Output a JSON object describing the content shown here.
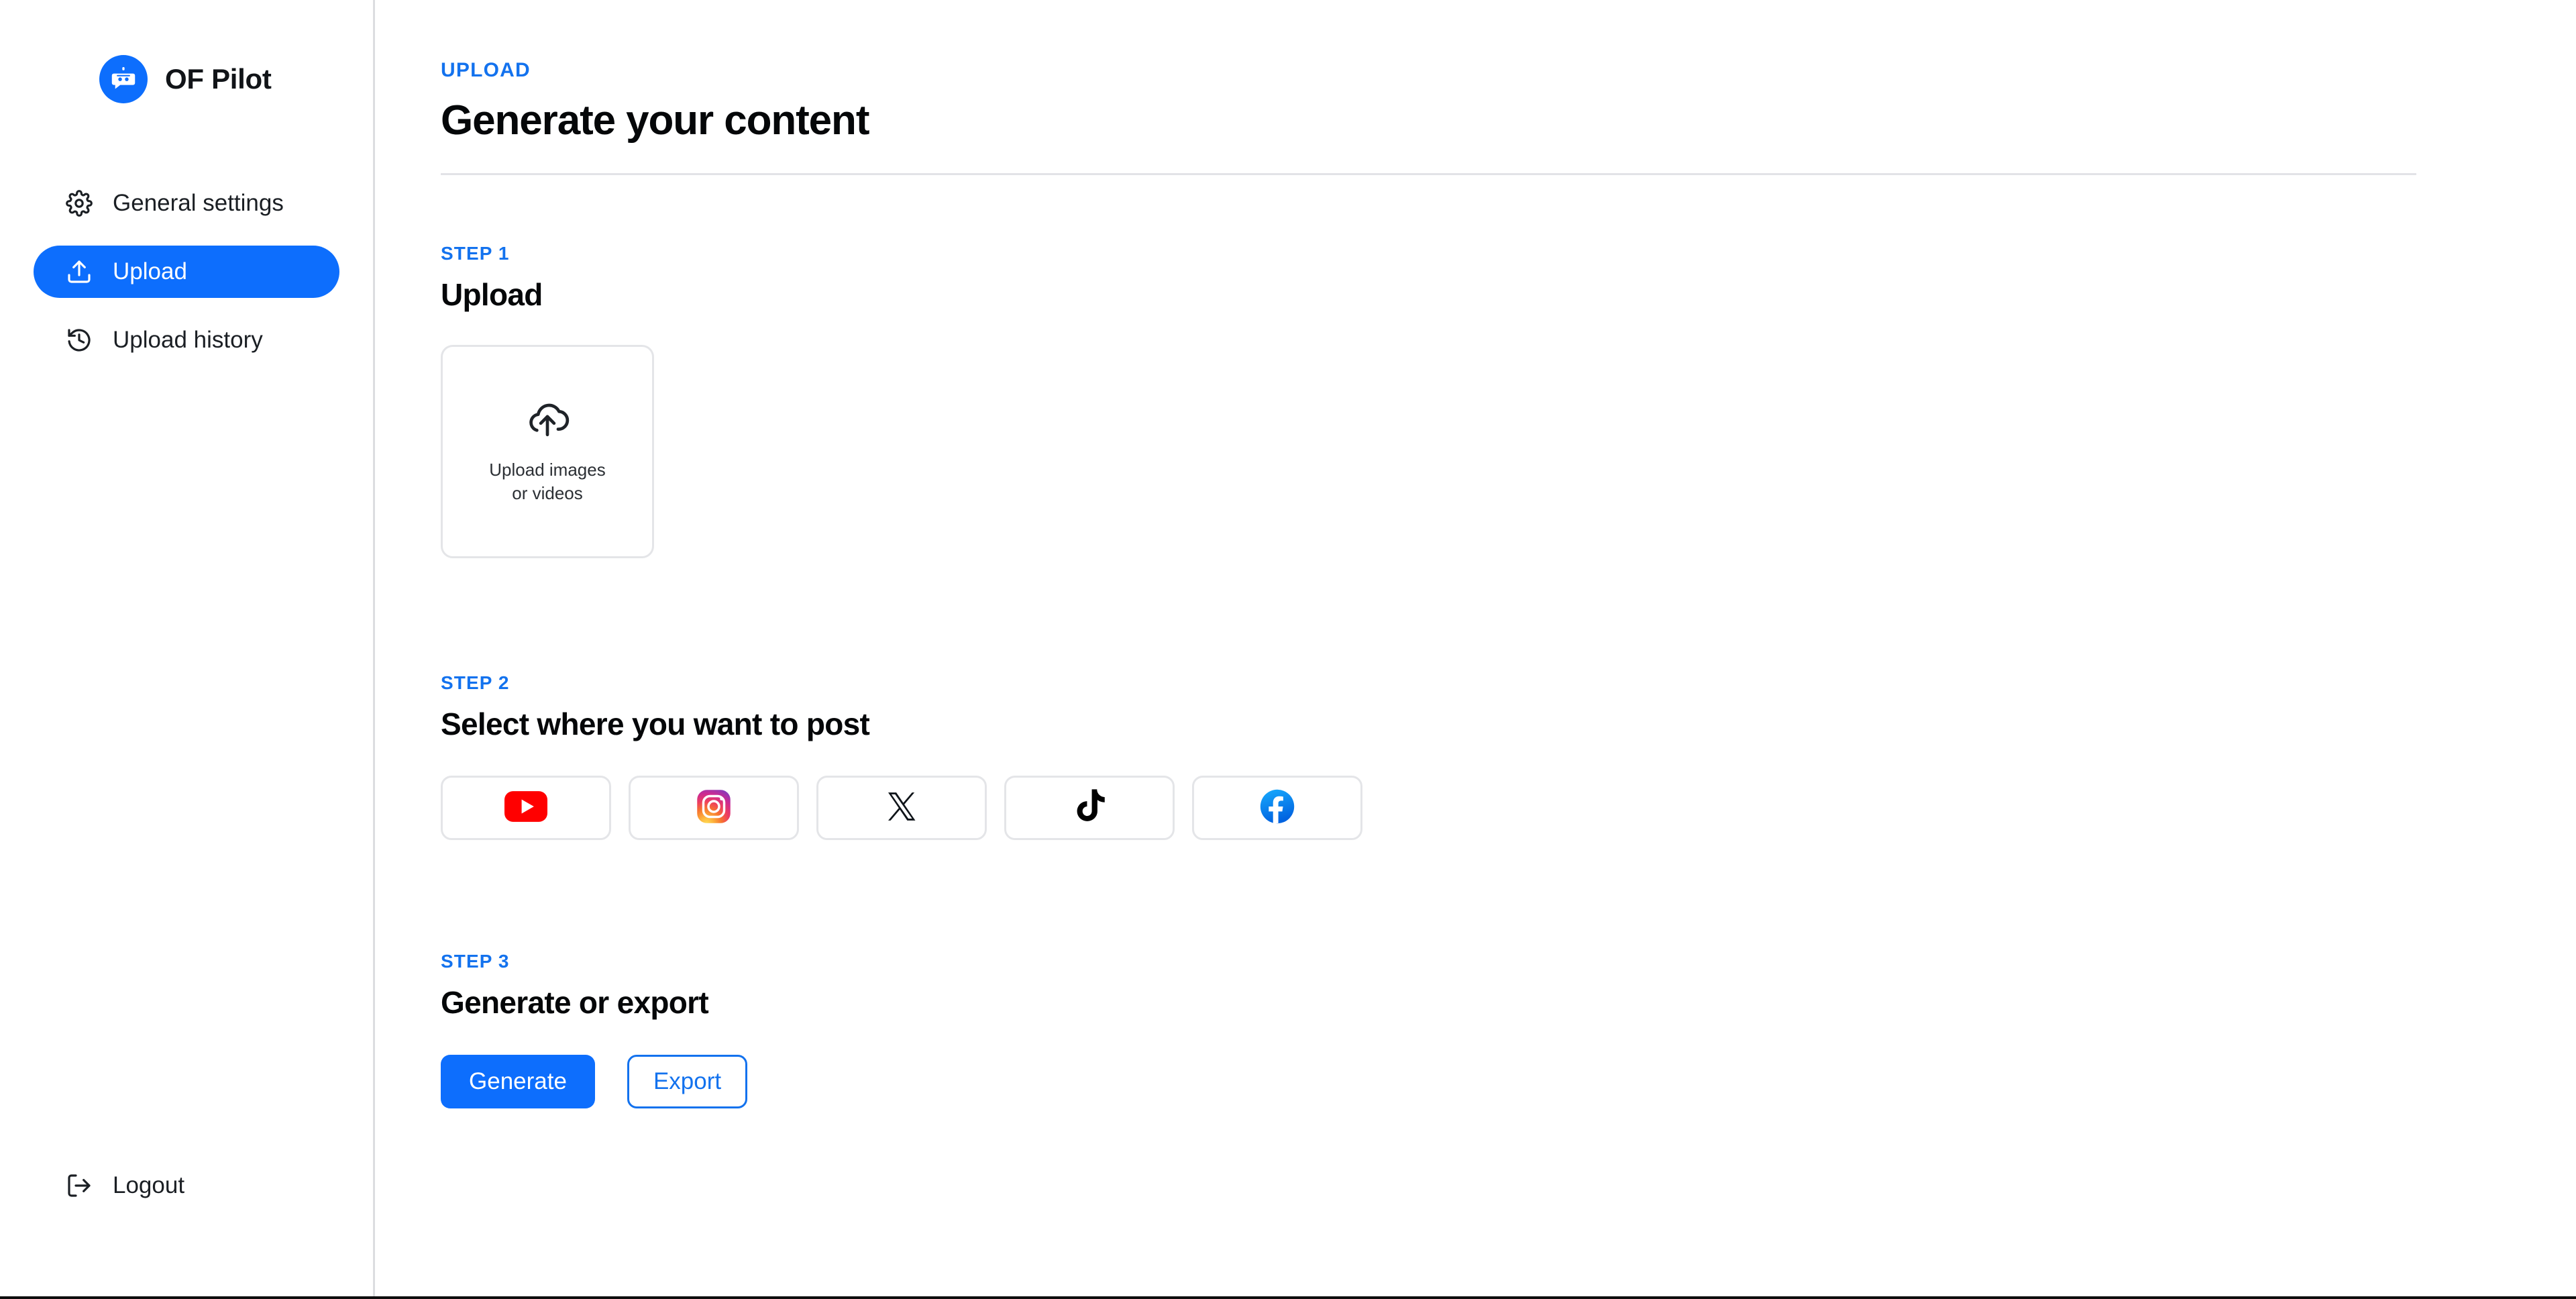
{
  "brand": {
    "name": "OF Pilot",
    "logo_icon": "robot-icon",
    "logo_color": "#0d6efd"
  },
  "sidebar": {
    "items": [
      {
        "label": "General settings",
        "icon": "gear-icon",
        "active": false
      },
      {
        "label": "Upload",
        "icon": "upload-icon",
        "active": true
      },
      {
        "label": "Upload history",
        "icon": "history-icon",
        "active": false
      }
    ],
    "footer": {
      "label": "Logout",
      "icon": "logout-icon"
    }
  },
  "header": {
    "eyebrow": "UPLOAD",
    "title": "Generate your content"
  },
  "steps": {
    "step1": {
      "eyebrow": "STEP 1",
      "title": "Upload",
      "dropzone": {
        "icon": "cloud-upload-icon",
        "label": "Upload images or videos"
      }
    },
    "step2": {
      "eyebrow": "STEP 2",
      "title": "Select where you want to post",
      "platforms": [
        {
          "name": "YouTube",
          "icon": "youtube-icon",
          "color": "#ff0000"
        },
        {
          "name": "Instagram",
          "icon": "instagram-icon",
          "color": "#dd2a7b"
        },
        {
          "name": "X",
          "icon": "x-twitter-icon",
          "color": "#000000"
        },
        {
          "name": "TikTok",
          "icon": "tiktok-icon",
          "color": "#000000"
        },
        {
          "name": "Facebook",
          "icon": "facebook-icon",
          "color": "#1877f2"
        }
      ]
    },
    "step3": {
      "eyebrow": "STEP 3",
      "title": "Generate or export",
      "generate_label": "Generate",
      "export_label": "Export"
    }
  },
  "theme": {
    "accent": "#0d6efd",
    "accent_text": "#1372ee",
    "border": "#e4e5e8",
    "text": "#050709",
    "background": "#ffffff"
  }
}
